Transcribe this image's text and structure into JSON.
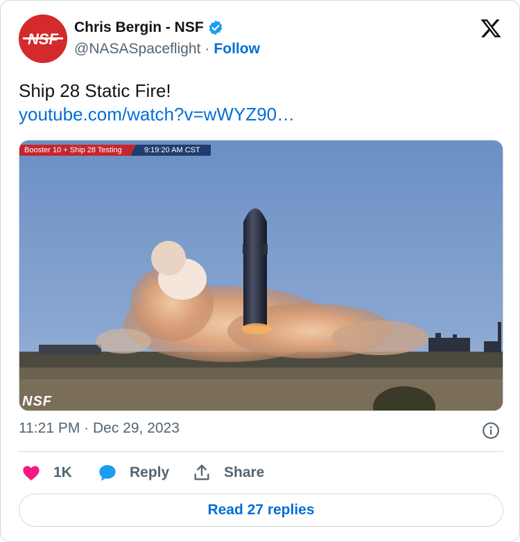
{
  "author": {
    "name": "Chris Bergin - NSF",
    "handle": "@NASASpaceflight",
    "follow_label": "Follow",
    "avatar_text": "NSF"
  },
  "tweet": {
    "text": "Ship 28 Static Fire!",
    "link": "youtube.com/watch?v=wWYZ90…"
  },
  "media": {
    "overlay_title": "Booster 10 + Ship 28 Testing",
    "overlay_time": "9:19:20 AM CST",
    "watermark": "NSF"
  },
  "meta": {
    "timestamp": "11:21 PM · Dec 29, 2023"
  },
  "actions": {
    "like_count": "1K",
    "reply_label": "Reply",
    "share_label": "Share",
    "read_replies": "Read 27 replies"
  },
  "icons": {
    "verified": "verified-badge-icon",
    "x": "x-logo-icon",
    "info": "info-icon",
    "heart": "heart-icon",
    "reply": "speech-bubble-icon",
    "share": "share-upload-icon"
  },
  "colors": {
    "link": "#006fd6",
    "heart": "#f91880",
    "verified": "#1d9bf0",
    "avatar_bg": "#d42a2c"
  }
}
